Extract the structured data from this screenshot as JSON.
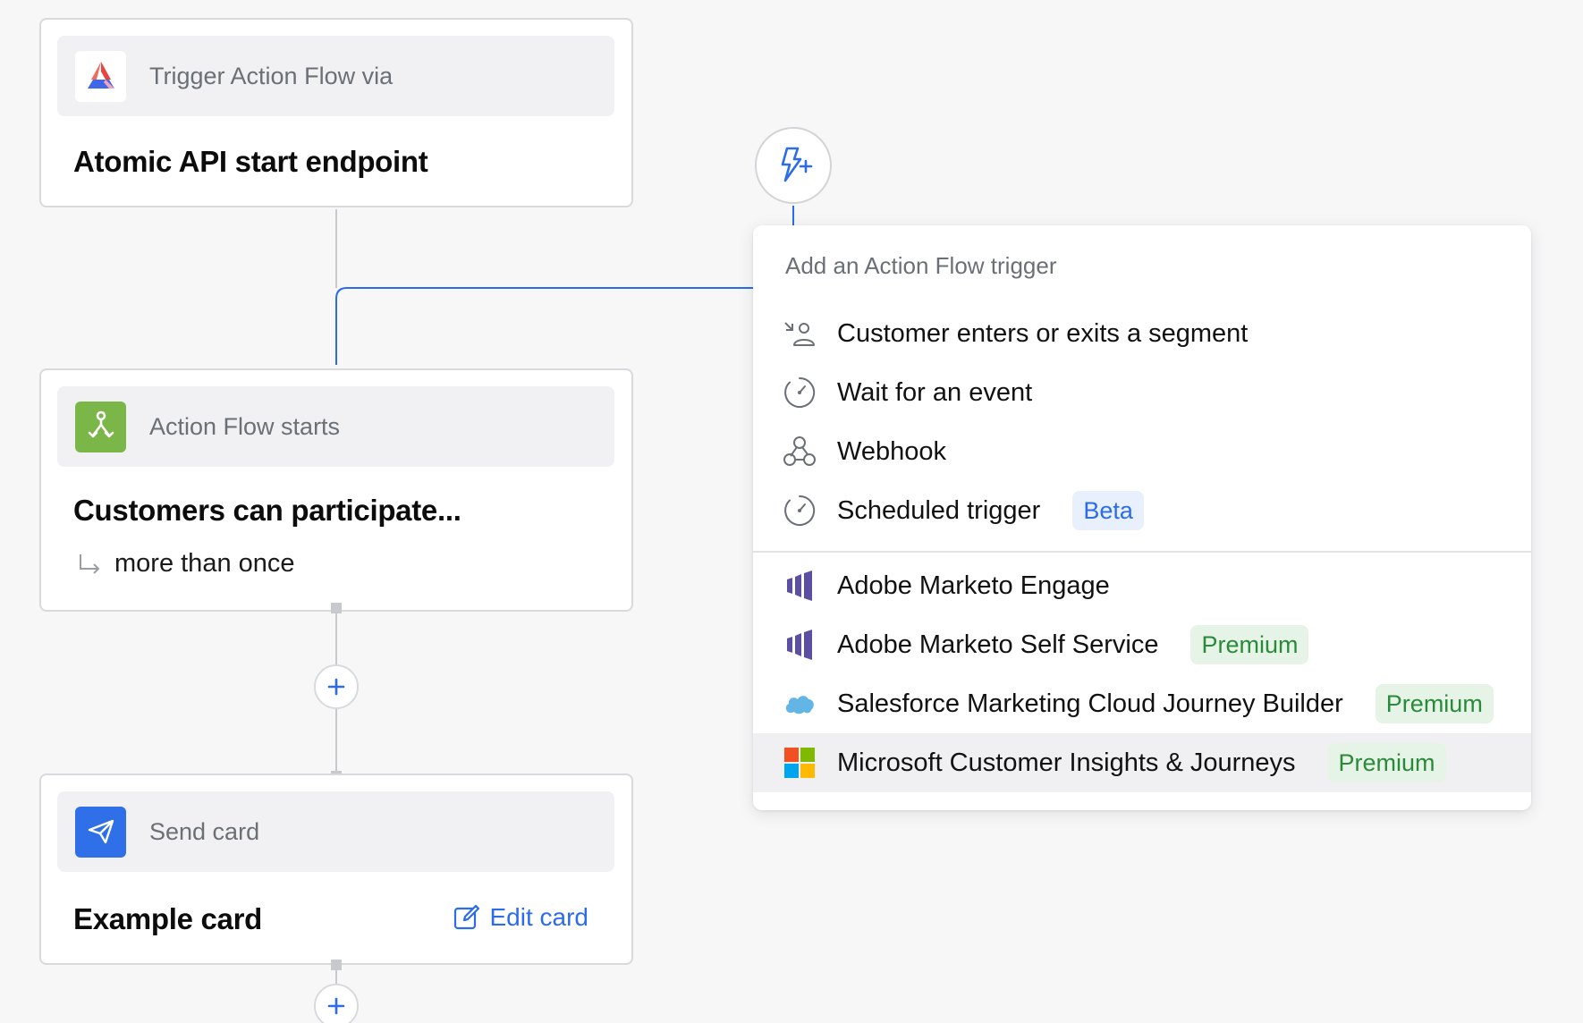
{
  "trigger_card": {
    "header_label": "Trigger Action Flow via",
    "title": "Atomic API start endpoint"
  },
  "start_card": {
    "header_label": "Action Flow starts",
    "title": "Customers can participate...",
    "subtitle": "more than once"
  },
  "send_card": {
    "header_label": "Send card",
    "title": "Example card",
    "edit_label": "Edit card"
  },
  "add_buttons": [
    "+",
    "+"
  ],
  "trigger_menu": {
    "title": "Add an Action Flow trigger",
    "items": [
      {
        "icon": "segment-icon",
        "label": "Customer enters or exits a segment",
        "badge": ""
      },
      {
        "icon": "timer-icon",
        "label": "Wait for an event",
        "badge": ""
      },
      {
        "icon": "webhook-icon",
        "label": "Webhook",
        "badge": ""
      },
      {
        "icon": "timer-icon",
        "label": "Scheduled trigger",
        "badge": "Beta"
      },
      {
        "icon": "marketo-icon",
        "label": "Adobe Marketo Engage",
        "badge": ""
      },
      {
        "icon": "marketo-icon",
        "label": "Adobe Marketo Self Service",
        "badge": "Premium"
      },
      {
        "icon": "salesforce-icon",
        "label": "Salesforce Marketing Cloud Journey Builder",
        "badge": "Premium"
      },
      {
        "icon": "microsoft-icon",
        "label": "Microsoft Customer Insights & Journeys",
        "badge": "Premium"
      }
    ]
  },
  "colors": {
    "accent": "#2c6cea",
    "action_flow_green": "#7ab648",
    "send_blue": "#2f6fe8",
    "premium_green": "#2a8a3a",
    "canvas_bg": "#f7f7f8"
  }
}
